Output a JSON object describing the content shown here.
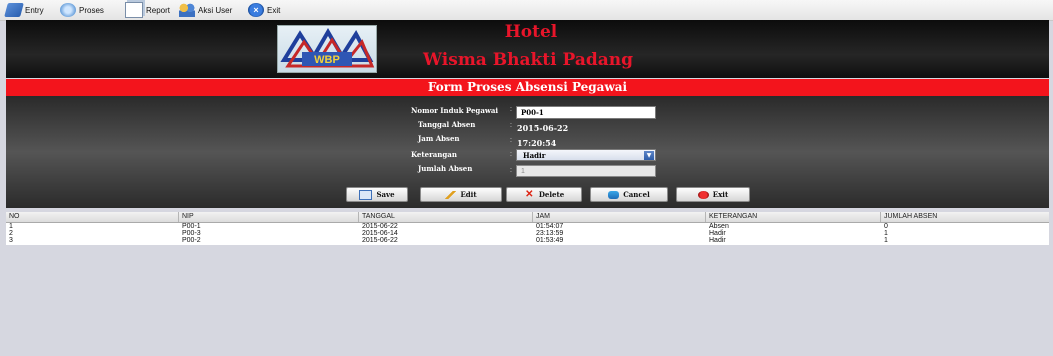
{
  "menu": [
    {
      "label": "Entry",
      "icon": "entry-icon"
    },
    {
      "label": "Proses",
      "icon": "proses-icon"
    },
    {
      "label": "Report",
      "icon": "report-icon"
    },
    {
      "label": "Aksi User",
      "icon": "user-icon"
    },
    {
      "label": "Exit",
      "icon": "exit-icon"
    }
  ],
  "header": {
    "logo_text": "WBP",
    "title_line1": "Hotel",
    "title_line2": "Wisma Bhakti Padang",
    "title_color": "#e8152a"
  },
  "form": {
    "title": "Form Proses Absensi Pegawai",
    "title_bar_color": "#f3141c",
    "fields": {
      "nip_label": "Nomor Induk Pegawai",
      "nip_value": "P00-1",
      "tanggal_label": "Tanggal Absen",
      "tanggal_value": "2015-06-22",
      "jam_label": "Jam Absen",
      "jam_value": "17:20:54",
      "keterangan_label": "Keterangan",
      "keterangan_value": "Hadir",
      "jumlah_label": "Jumlah Absen",
      "jumlah_value": "1",
      "colon": ":"
    },
    "buttons": {
      "save": "Save",
      "edit": "Edit",
      "delete": "Delete",
      "cancel": "Cancel",
      "exit": "Exit"
    }
  },
  "table": {
    "columns": [
      "NO",
      "NIP",
      "TANGGAL",
      "JAM",
      "KETERANGAN",
      "JUMLAH ABSEN"
    ],
    "rows": [
      [
        "1",
        "P00-1",
        "2015-06-22",
        "01:54:07",
        "Absen",
        "0"
      ],
      [
        "2",
        "P00-3",
        "2015-06-14",
        "23:13:59",
        "Hadir",
        "1"
      ],
      [
        "3",
        "P00-2",
        "2015-06-22",
        "01:53:49",
        "Hadir",
        "1"
      ]
    ]
  }
}
